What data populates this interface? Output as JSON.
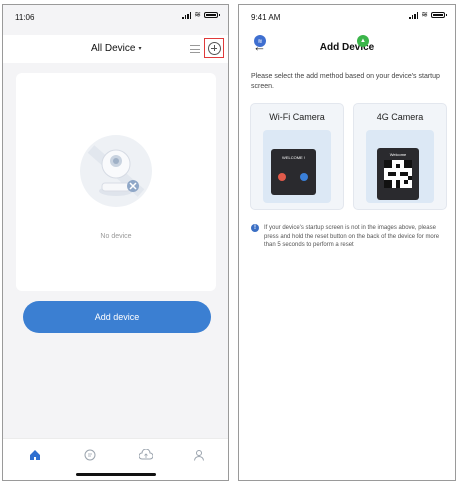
{
  "left_screen": {
    "status": {
      "time": "11:06"
    },
    "header": {
      "title": "All Device",
      "caret": "▾"
    },
    "empty_state": {
      "text": "No device"
    },
    "add_button": {
      "label": "Add device"
    },
    "nav": {
      "items": [
        "home-icon",
        "message-icon",
        "cloud-icon",
        "profile-icon"
      ],
      "active_color": "#2f6fd0"
    }
  },
  "right_screen": {
    "status": {
      "time": "9:41 AM"
    },
    "header": {
      "back": "←",
      "title": "Add Device"
    },
    "instruction": "Please select the add method based on your device's startup screen.",
    "methods": [
      {
        "label": "Wi-Fi Camera",
        "screen_text": "WELCOME !",
        "badge_icon": "wifi-icon",
        "badge_color": "#3f6fd0"
      },
      {
        "label": "4G Camera",
        "screen_text": "Welcome",
        "badge_icon": "signal-icon",
        "badge_color": "#3bb54a"
      }
    ],
    "note": {
      "icon": "!",
      "text": "If your device's startup screen is not in the images above, please press and hold the reset button on the back of the device for more than 5 seconds to perform a reset"
    }
  },
  "colors": {
    "accent": "#3b7fd2",
    "highlight": "#e03a3a"
  }
}
